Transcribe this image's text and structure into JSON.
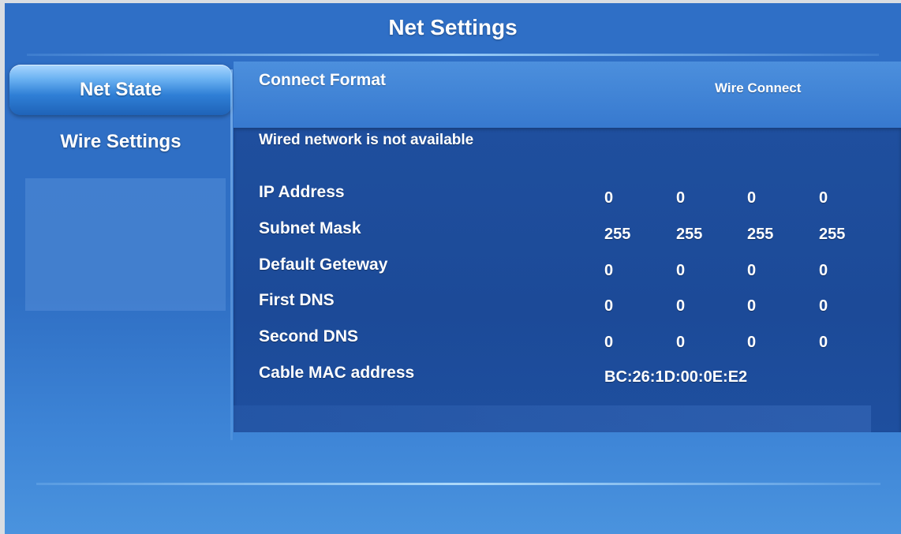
{
  "window": {
    "title": "Net Settings"
  },
  "sidebar": {
    "items": [
      {
        "label": "Net State",
        "selected": true
      },
      {
        "label": "Wire Settings",
        "selected": false
      }
    ]
  },
  "connect_format": {
    "label": "Connect Format",
    "value": "Wire Connect"
  },
  "status": "Wired network is not available",
  "network": {
    "ip_address": {
      "label": "IP Address",
      "octets": [
        "0",
        "0",
        "0",
        "0"
      ]
    },
    "subnet_mask": {
      "label": "Subnet Mask",
      "octets": [
        "255",
        "255",
        "255",
        "255"
      ]
    },
    "default_gateway": {
      "label": "Default Geteway",
      "octets": [
        "0",
        "0",
        "0",
        "0"
      ]
    },
    "first_dns": {
      "label": "First DNS",
      "octets": [
        "0",
        "0",
        "0",
        "0"
      ]
    },
    "second_dns": {
      "label": "Second DNS",
      "octets": [
        "0",
        "0",
        "0",
        "0"
      ]
    },
    "mac": {
      "label": "Cable MAC address",
      "value": "BC:26:1D:00:0E:E2"
    }
  },
  "colors": {
    "background": "#2f6fc6",
    "panel": "#1f4f9e",
    "selected_item": "#6bb2f2",
    "text": "#ffffff"
  }
}
